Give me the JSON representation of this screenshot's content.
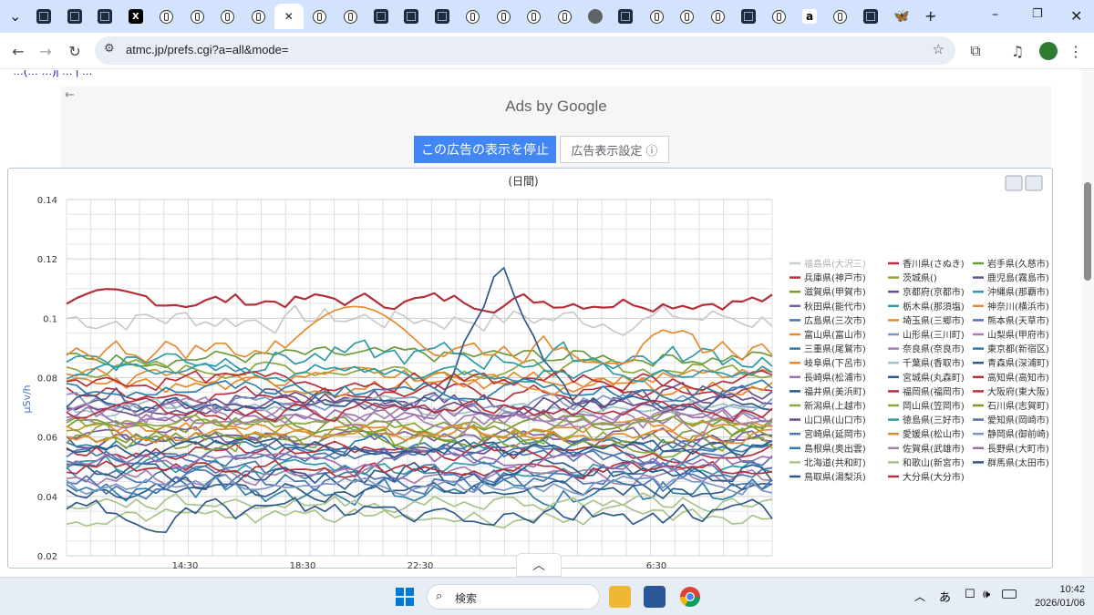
{
  "browser": {
    "tabs": [
      {
        "icon": "dark-square"
      },
      {
        "icon": "dark-square"
      },
      {
        "icon": "dark-square"
      },
      {
        "icon": "x-logo"
      },
      {
        "icon": "circle-logo"
      },
      {
        "icon": "circle-logo"
      },
      {
        "icon": "circle-logo"
      },
      {
        "icon": "circle-logo"
      },
      {
        "icon": "close-active"
      },
      {
        "icon": "circle-logo"
      },
      {
        "icon": "circle-logo"
      },
      {
        "icon": "dark-square"
      },
      {
        "icon": "dark-square"
      },
      {
        "icon": "dark-square"
      },
      {
        "icon": "circle-logo"
      },
      {
        "icon": "circle-logo"
      },
      {
        "icon": "circle-logo"
      },
      {
        "icon": "circle-logo"
      },
      {
        "icon": "globe"
      },
      {
        "icon": "dark-square"
      },
      {
        "icon": "circle-logo"
      },
      {
        "icon": "circle-logo"
      },
      {
        "icon": "circle-logo"
      },
      {
        "icon": "dark-square"
      },
      {
        "icon": "circle-logo"
      },
      {
        "icon": "amazon-logo"
      },
      {
        "icon": "circle-logo"
      },
      {
        "icon": "dark-square"
      },
      {
        "icon": "bluesky-logo"
      },
      {
        "icon": "dots-logo"
      }
    ],
    "url": "atmc.jp/prefs.cgi?a=all&mode="
  },
  "page": {
    "top_links": "…(… …)| … | …",
    "ad": {
      "title": "Ads by Google",
      "stop_button": "この広告の表示を停止",
      "settings_button": "広告表示設定 ⓘ"
    }
  },
  "chart_data": {
    "type": "line",
    "title": "(日間)",
    "ylabel": "μSv/h",
    "ylim": [
      0.02,
      0.14
    ],
    "yticks": [
      "0.14",
      "0.12",
      "0.1",
      "0.08",
      "0.06",
      "0.04",
      "0.02"
    ],
    "xticks": [
      "14:30",
      "18:30",
      "22:30",
      "6:30"
    ],
    "grid": true,
    "legend_position": "right",
    "series": [
      {
        "name": "福島県(大沢三)",
        "color": "#c9c9c9",
        "base": 0.1
      },
      {
        "name": "香川県(さぬき)",
        "color": "#b5303a",
        "base": 0.106
      },
      {
        "name": "岩手県(久慈市)",
        "color": "#6b9a3c",
        "base": 0.087
      },
      {
        "name": "兵庫県(神戸市)",
        "color": "#b5303a",
        "base": 0.075
      },
      {
        "name": "茨城県()",
        "color": "#8aa83e",
        "base": 0.083
      },
      {
        "name": "鹿児島(霧島市)",
        "color": "#6c4f8f",
        "base": 0.073
      },
      {
        "name": "滋賀県(甲賀市)",
        "color": "#7a9a33",
        "base": 0.065
      },
      {
        "name": "京都府(京都市)",
        "color": "#6c4f8f",
        "base": 0.058
      },
      {
        "name": "沖縄県(那覇市)",
        "color": "#2d9ba8",
        "base": 0.05
      },
      {
        "name": "秋田県(能代市)",
        "color": "#7a5fa0",
        "base": 0.06
      },
      {
        "name": "栃木県(那須塩)",
        "color": "#2d9ba8",
        "base": 0.087
      },
      {
        "name": "神奈川(横浜市)",
        "color": "#e58a2e",
        "base": 0.08
      },
      {
        "name": "広島県(三次市)",
        "color": "#4a74b4",
        "base": 0.048
      },
      {
        "name": "埼玉県(三郷市)",
        "color": "#e58a2e",
        "base": 0.063
      },
      {
        "name": "熊本県(天草市)",
        "color": "#4a74b4",
        "base": 0.054
      },
      {
        "name": "富山県(富山市)",
        "color": "#e58a2e",
        "base": 0.09
      },
      {
        "name": "山形県(三川町)",
        "color": "#7d95c4",
        "base": 0.072
      },
      {
        "name": "山梨県(甲府市)",
        "color": "#a57fb0",
        "base": 0.066
      },
      {
        "name": "三重県(尾鷲市)",
        "color": "#2d7ea8",
        "base": 0.058
      },
      {
        "name": "奈良県(奈良市)",
        "color": "#a57fb0",
        "base": 0.047
      },
      {
        "name": "東京都(新宿区)",
        "color": "#2d7ea8",
        "base": 0.042
      },
      {
        "name": "岐阜県(下呂市)",
        "color": "#e58a2e",
        "base": 0.077
      },
      {
        "name": "千葉県(香取市)",
        "color": "#9cc2c6",
        "base": 0.07
      },
      {
        "name": "青森県(深浦町)",
        "color": "#2d5a8a",
        "base": 0.072
      },
      {
        "name": "長崎県(松浦市)",
        "color": "#9a6fb0",
        "base": 0.068
      },
      {
        "name": "宮城県(丸森町)",
        "color": "#2d5a8a",
        "base": 0.047
      },
      {
        "name": "高知県(高知市)",
        "color": "#b5303a",
        "base": 0.079
      },
      {
        "name": "福井県(美浜町)",
        "color": "#2d5a8a",
        "base": 0.042
      },
      {
        "name": "福岡県(福岡市)",
        "color": "#b5303a",
        "base": 0.049
      },
      {
        "name": "大阪府(東大阪)",
        "color": "#b5303a",
        "base": 0.055
      },
      {
        "name": "新潟県(上越市)",
        "color": "#8aa83e",
        "base": 0.059
      },
      {
        "name": "岡山県(笠岡市)",
        "color": "#8aa83e",
        "base": 0.064
      },
      {
        "name": "石川県(志賀町)",
        "color": "#7a9a33",
        "base": 0.06
      },
      {
        "name": "山口県(山口市)",
        "color": "#6c4f8f",
        "base": 0.071
      },
      {
        "name": "徳島県(三好市)",
        "color": "#2d9ba8",
        "base": 0.082
      },
      {
        "name": "愛知県(岡崎市)",
        "color": "#4a74b4",
        "base": 0.045
      },
      {
        "name": "宮崎県(延岡市)",
        "color": "#4a74b4",
        "base": 0.053
      },
      {
        "name": "愛媛県(松山市)",
        "color": "#e58a2e",
        "base": 0.061
      },
      {
        "name": "静岡県(御前崎)",
        "color": "#7d95c4",
        "base": 0.044
      },
      {
        "name": "島根県(奥出雲)",
        "color": "#2d7ea8",
        "base": 0.076
      },
      {
        "name": "佐賀県(武雄市)",
        "color": "#a57fb0",
        "base": 0.067
      },
      {
        "name": "長野県(大町市)",
        "color": "#9a6fb0",
        "base": 0.052
      },
      {
        "name": "北海道(共和町)",
        "color": "#a8c48a",
        "base": 0.038
      },
      {
        "name": "和歌山(新宮市)",
        "color": "#a8c48a",
        "base": 0.033
      },
      {
        "name": "群馬県(太田市)",
        "color": "#2d5a8a",
        "base": 0.056
      },
      {
        "name": "鳥取県(湯梨浜)",
        "color": "#2d5a8a",
        "base": 0.035
      },
      {
        "name": "大分県(大分市)",
        "color": "#b5303a",
        "base": 0.069
      }
    ]
  },
  "taskbar": {
    "search_label": "検索",
    "ime": "あ",
    "time": "10:42",
    "date": "2026/01/06"
  }
}
